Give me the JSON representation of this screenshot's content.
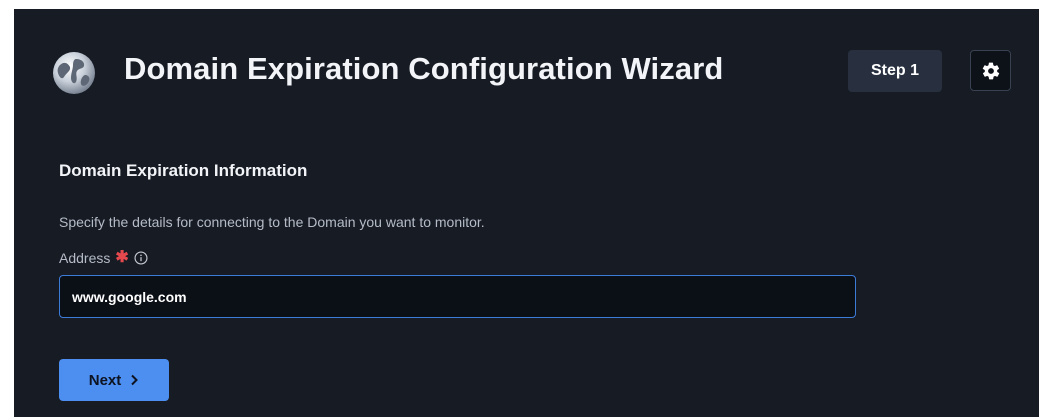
{
  "header": {
    "title": "Domain Expiration Configuration Wizard",
    "logo_icon": "globe-icon",
    "step_label": "Step 1",
    "settings_icon": "gear-icon"
  },
  "form": {
    "section_title": "Domain Expiration Information",
    "description": "Specify the details for connecting to the Domain you want to monitor.",
    "address_label": "Address",
    "required_marker": "✱",
    "info_icon": "info-circle-icon",
    "address_value": "www.google.com"
  },
  "actions": {
    "next_label": "Next",
    "next_icon": "chevron-right-icon"
  },
  "colors": {
    "background": "#161b24",
    "accent": "#4c8ff0",
    "input_border": "#3d7bd9",
    "required": "#e5484d"
  }
}
